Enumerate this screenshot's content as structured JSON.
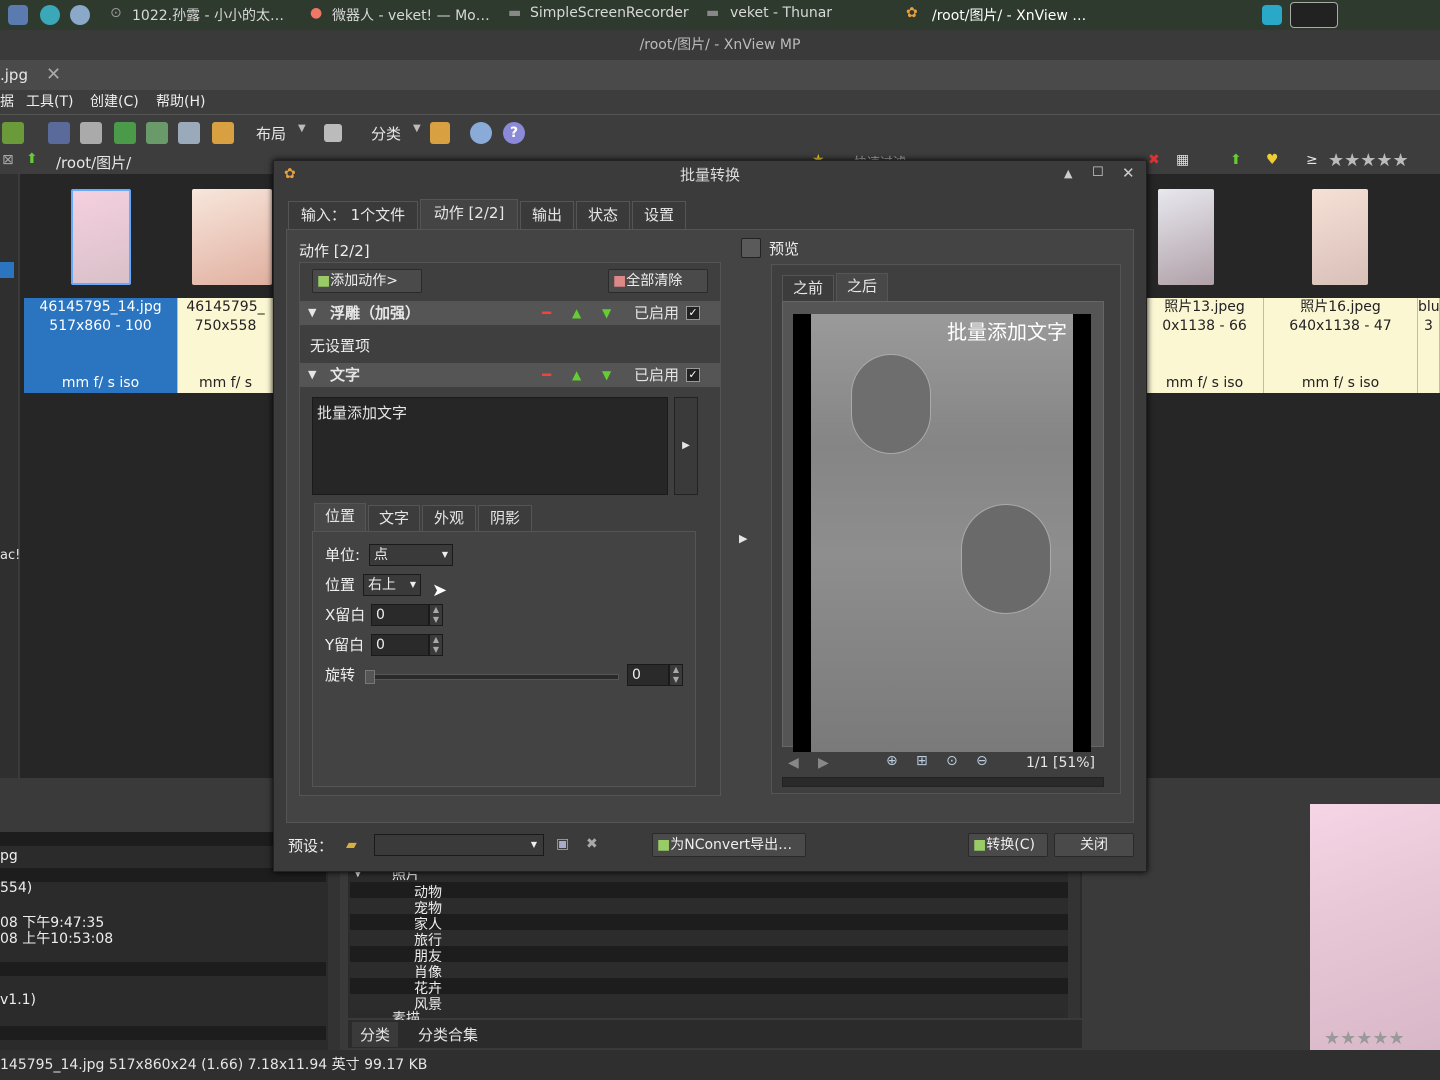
{
  "taskbar": {
    "items": [
      "1022.孙露 - 小小的太…",
      "微器人 - veket! — Mo…",
      "SimpleScreenRecorder",
      "veket - Thunar",
      "/root/图片/ - XnView …"
    ]
  },
  "window_title": "/root/图片/ - XnView MP",
  "tab": {
    "label": ".jpg"
  },
  "menu": {
    "data": "据",
    "tools": "工具(T)",
    "create": "创建(C)",
    "help": "帮助(H)"
  },
  "toolbar": {
    "layout": "布局",
    "classify": "分类"
  },
  "path": "/root/图片/",
  "right_toolbar": {
    "filter": "快速过滤",
    "ge": "≥"
  },
  "thumbnails": [
    {
      "name": "46145795_14.jpg",
      "dims": "517x860 - 100",
      "exif": "mm f/ s iso"
    },
    {
      "name": "46145795_",
      "dims": "750x558",
      "exif": "mm f/ s"
    },
    {
      "name": "照片13.jpeg",
      "dims": "0x1138 - 66",
      "exif": "mm f/ s iso"
    },
    {
      "name": "照片16.jpeg",
      "dims": "640x1138 - 47",
      "exif": "mm f/ s iso"
    },
    {
      "name": "blu",
      "dims": "3",
      "exif": ""
    }
  ],
  "left_strip": {
    "label": "ac!"
  },
  "bottom_left": {
    "lines": [
      "pg",
      "554)",
      "08 下午9:47:35",
      "08 上午10:53:08",
      "v1.1)"
    ]
  },
  "categories": {
    "root": "照片",
    "items": [
      "动物",
      "宠物",
      "家人",
      "旅行",
      "朋友",
      "肖像",
      "花卉",
      "风景"
    ],
    "next_root": "素描"
  },
  "bottom_tabs": {
    "tab1": "分类",
    "tab2": "分类合集"
  },
  "statusbar": "145795_14.jpg  517x860x24 (1.66)  7.18x11.94 英寸  99.17 KB",
  "dialog": {
    "title": "批量转换",
    "tabs": [
      "输入： 1个文件",
      "动作 [2/2]",
      "输出",
      "状态",
      "设置"
    ],
    "actions_heading": "动作 [2/2]",
    "add_action": "添加动作>",
    "clear_all": "全部清除",
    "action1": {
      "title": "浮雕（加强）",
      "enabled": "已启用",
      "body": "无设置项"
    },
    "action2": {
      "title": "文字",
      "enabled": "已启用",
      "text": "批量添加文字"
    },
    "subtabs": [
      "位置",
      "文字",
      "外观",
      "阴影"
    ],
    "unit_label": "单位:",
    "unit_value": "点",
    "position_label": "位置",
    "position_value": "右上",
    "xmargin_label": "X留白",
    "xmargin_value": "0",
    "ymargin_label": "Y留白",
    "ymargin_value": "0",
    "rotate_label": "旋转",
    "rotate_value": "0",
    "preview_label": "预览",
    "preview_tabs": [
      "之前",
      "之后"
    ],
    "preview_overlay": "批量添加文字",
    "preview_page": "1/1 [51%]",
    "preset_label": "预设：",
    "export_btn": "为NConvert导出…",
    "convert_btn": "转换(C)",
    "close_btn": "关闭"
  }
}
